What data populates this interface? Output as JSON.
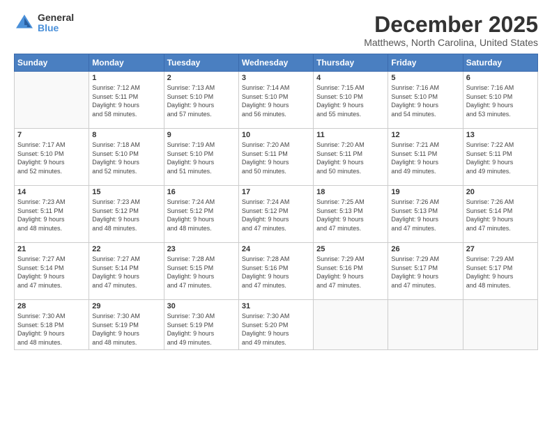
{
  "logo": {
    "general": "General",
    "blue": "Blue"
  },
  "title": "December 2025",
  "location": "Matthews, North Carolina, United States",
  "days_header": [
    "Sunday",
    "Monday",
    "Tuesday",
    "Wednesday",
    "Thursday",
    "Friday",
    "Saturday"
  ],
  "weeks": [
    [
      {
        "num": "",
        "info": ""
      },
      {
        "num": "1",
        "info": "Sunrise: 7:12 AM\nSunset: 5:11 PM\nDaylight: 9 hours\nand 58 minutes."
      },
      {
        "num": "2",
        "info": "Sunrise: 7:13 AM\nSunset: 5:10 PM\nDaylight: 9 hours\nand 57 minutes."
      },
      {
        "num": "3",
        "info": "Sunrise: 7:14 AM\nSunset: 5:10 PM\nDaylight: 9 hours\nand 56 minutes."
      },
      {
        "num": "4",
        "info": "Sunrise: 7:15 AM\nSunset: 5:10 PM\nDaylight: 9 hours\nand 55 minutes."
      },
      {
        "num": "5",
        "info": "Sunrise: 7:16 AM\nSunset: 5:10 PM\nDaylight: 9 hours\nand 54 minutes."
      },
      {
        "num": "6",
        "info": "Sunrise: 7:16 AM\nSunset: 5:10 PM\nDaylight: 9 hours\nand 53 minutes."
      }
    ],
    [
      {
        "num": "7",
        "info": "Sunrise: 7:17 AM\nSunset: 5:10 PM\nDaylight: 9 hours\nand 52 minutes."
      },
      {
        "num": "8",
        "info": "Sunrise: 7:18 AM\nSunset: 5:10 PM\nDaylight: 9 hours\nand 52 minutes."
      },
      {
        "num": "9",
        "info": "Sunrise: 7:19 AM\nSunset: 5:10 PM\nDaylight: 9 hours\nand 51 minutes."
      },
      {
        "num": "10",
        "info": "Sunrise: 7:20 AM\nSunset: 5:11 PM\nDaylight: 9 hours\nand 50 minutes."
      },
      {
        "num": "11",
        "info": "Sunrise: 7:20 AM\nSunset: 5:11 PM\nDaylight: 9 hours\nand 50 minutes."
      },
      {
        "num": "12",
        "info": "Sunrise: 7:21 AM\nSunset: 5:11 PM\nDaylight: 9 hours\nand 49 minutes."
      },
      {
        "num": "13",
        "info": "Sunrise: 7:22 AM\nSunset: 5:11 PM\nDaylight: 9 hours\nand 49 minutes."
      }
    ],
    [
      {
        "num": "14",
        "info": "Sunrise: 7:23 AM\nSunset: 5:11 PM\nDaylight: 9 hours\nand 48 minutes."
      },
      {
        "num": "15",
        "info": "Sunrise: 7:23 AM\nSunset: 5:12 PM\nDaylight: 9 hours\nand 48 minutes."
      },
      {
        "num": "16",
        "info": "Sunrise: 7:24 AM\nSunset: 5:12 PM\nDaylight: 9 hours\nand 48 minutes."
      },
      {
        "num": "17",
        "info": "Sunrise: 7:24 AM\nSunset: 5:12 PM\nDaylight: 9 hours\nand 47 minutes."
      },
      {
        "num": "18",
        "info": "Sunrise: 7:25 AM\nSunset: 5:13 PM\nDaylight: 9 hours\nand 47 minutes."
      },
      {
        "num": "19",
        "info": "Sunrise: 7:26 AM\nSunset: 5:13 PM\nDaylight: 9 hours\nand 47 minutes."
      },
      {
        "num": "20",
        "info": "Sunrise: 7:26 AM\nSunset: 5:14 PM\nDaylight: 9 hours\nand 47 minutes."
      }
    ],
    [
      {
        "num": "21",
        "info": "Sunrise: 7:27 AM\nSunset: 5:14 PM\nDaylight: 9 hours\nand 47 minutes."
      },
      {
        "num": "22",
        "info": "Sunrise: 7:27 AM\nSunset: 5:14 PM\nDaylight: 9 hours\nand 47 minutes."
      },
      {
        "num": "23",
        "info": "Sunrise: 7:28 AM\nSunset: 5:15 PM\nDaylight: 9 hours\nand 47 minutes."
      },
      {
        "num": "24",
        "info": "Sunrise: 7:28 AM\nSunset: 5:16 PM\nDaylight: 9 hours\nand 47 minutes."
      },
      {
        "num": "25",
        "info": "Sunrise: 7:29 AM\nSunset: 5:16 PM\nDaylight: 9 hours\nand 47 minutes."
      },
      {
        "num": "26",
        "info": "Sunrise: 7:29 AM\nSunset: 5:17 PM\nDaylight: 9 hours\nand 47 minutes."
      },
      {
        "num": "27",
        "info": "Sunrise: 7:29 AM\nSunset: 5:17 PM\nDaylight: 9 hours\nand 48 minutes."
      }
    ],
    [
      {
        "num": "28",
        "info": "Sunrise: 7:30 AM\nSunset: 5:18 PM\nDaylight: 9 hours\nand 48 minutes."
      },
      {
        "num": "29",
        "info": "Sunrise: 7:30 AM\nSunset: 5:19 PM\nDaylight: 9 hours\nand 48 minutes."
      },
      {
        "num": "30",
        "info": "Sunrise: 7:30 AM\nSunset: 5:19 PM\nDaylight: 9 hours\nand 49 minutes."
      },
      {
        "num": "31",
        "info": "Sunrise: 7:30 AM\nSunset: 5:20 PM\nDaylight: 9 hours\nand 49 minutes."
      },
      {
        "num": "",
        "info": ""
      },
      {
        "num": "",
        "info": ""
      },
      {
        "num": "",
        "info": ""
      }
    ]
  ]
}
